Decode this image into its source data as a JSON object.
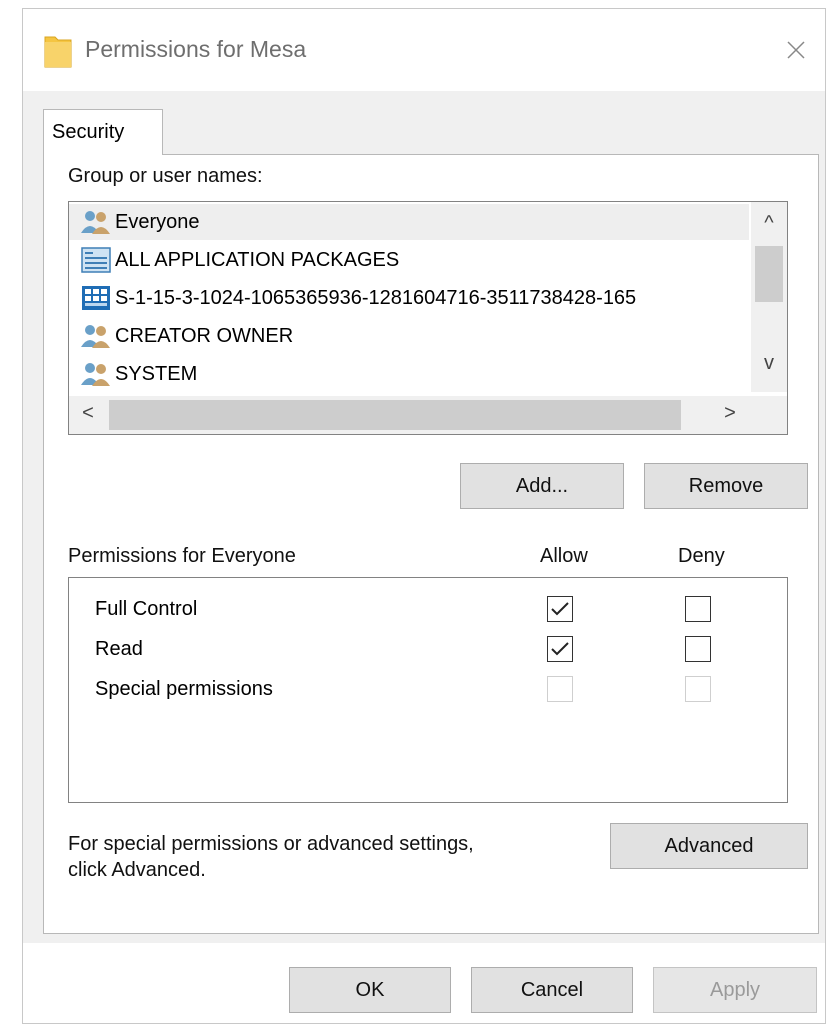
{
  "window": {
    "title": "Permissions for Mesa",
    "folder_icon": "folder-icon",
    "close_icon": "close-icon"
  },
  "tabs": [
    {
      "label": "Security",
      "active": true
    }
  ],
  "group_section": {
    "label": "Group or user names:",
    "users": [
      {
        "name": "Everyone",
        "icon": "users-group-icon",
        "selected": true
      },
      {
        "name": "ALL APPLICATION PACKAGES",
        "icon": "app-packages-icon",
        "selected": false
      },
      {
        "name": "S-1-15-3-1024-1065365936-1281604716-3511738428-165",
        "icon": "capability-sid-icon",
        "selected": false
      },
      {
        "name": "CREATOR OWNER",
        "icon": "users-group-icon",
        "selected": false
      },
      {
        "name": "SYSTEM",
        "icon": "users-group-icon",
        "selected": false
      }
    ],
    "scroll": {
      "up_arrow": "^",
      "down_arrow": "v",
      "left_arrow": "<",
      "right_arrow": ">"
    },
    "buttons": {
      "add": "Add...",
      "remove": "Remove"
    }
  },
  "permissions": {
    "heading": "Permissions for Everyone",
    "allow_label": "Allow",
    "deny_label": "Deny",
    "rows": [
      {
        "name": "Full Control",
        "allow": true,
        "deny": false,
        "enabled": true
      },
      {
        "name": "Read",
        "allow": true,
        "deny": false,
        "enabled": true
      },
      {
        "name": "Special permissions",
        "allow": false,
        "deny": false,
        "enabled": false
      }
    ]
  },
  "advanced": {
    "text_line1": "For special permissions or advanced settings,",
    "text_line2": "click Advanced.",
    "button": "Advanced"
  },
  "footer": {
    "ok": "OK",
    "cancel": "Cancel",
    "apply": "Apply",
    "apply_enabled": false
  },
  "colors": {
    "selection": "#eeeeee",
    "button_face": "#e1e1e1",
    "dialog_bg": "#f0f0f0",
    "folder": "#f5c542"
  }
}
